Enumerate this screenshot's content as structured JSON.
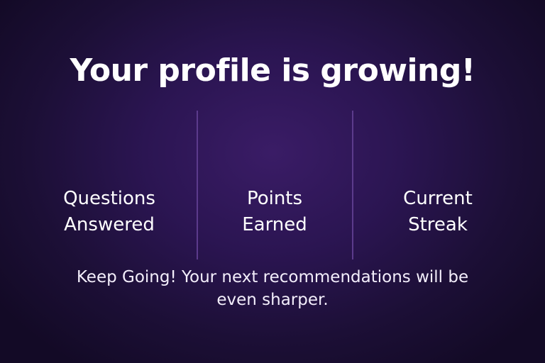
{
  "screen": {
    "title": "Your profile is growing!",
    "stats": [
      {
        "line1": "Questions",
        "line2": "Answered"
      },
      {
        "line1": "Points",
        "line2": "Earned"
      },
      {
        "line1": "Current",
        "line2": "Streak"
      }
    ],
    "message": "Keep Going! Your next recommendations will be even sharper."
  },
  "colors": {
    "background_center": "#3a1c66",
    "background_edge": "#130a26",
    "divider": "#5c3b8c",
    "text": "#ffffff"
  }
}
